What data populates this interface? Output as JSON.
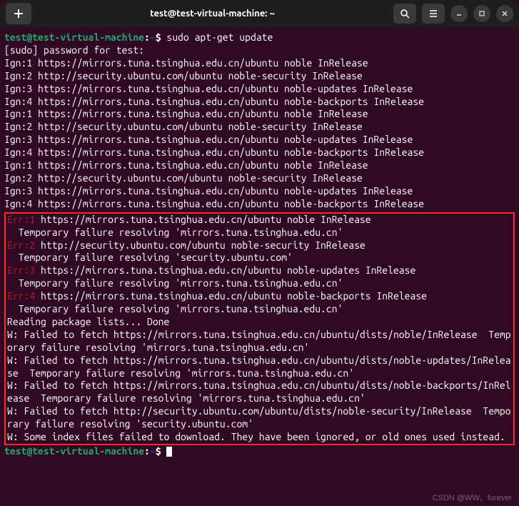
{
  "titlebar": {
    "title": "test@test-virtual-machine: ~"
  },
  "prompt": {
    "user_host": "test@test-virtual-machine",
    "sep": ":",
    "path": "~",
    "dollar": "$"
  },
  "command": "sudo apt-get update",
  "lines": {
    "sudo_pw": "[sudo] password for test:",
    "reading_done": "Reading package lists... Done"
  },
  "ign_block": [
    "Ign:1 https://mirrors.tuna.tsinghua.edu.cn/ubuntu noble InRelease",
    "Ign:2 http://security.ubuntu.com/ubuntu noble-security InRelease",
    "Ign:3 https://mirrors.tuna.tsinghua.edu.cn/ubuntu noble-updates InRelease",
    "Ign:4 https://mirrors.tuna.tsinghua.edu.cn/ubuntu noble-backports InRelease",
    "Ign:1 https://mirrors.tuna.tsinghua.edu.cn/ubuntu noble InRelease",
    "Ign:2 http://security.ubuntu.com/ubuntu noble-security InRelease",
    "Ign:3 https://mirrors.tuna.tsinghua.edu.cn/ubuntu noble-updates InRelease",
    "Ign:4 https://mirrors.tuna.tsinghua.edu.cn/ubuntu noble-backports InRelease",
    "Ign:1 https://mirrors.tuna.tsinghua.edu.cn/ubuntu noble InRelease",
    "Ign:2 http://security.ubuntu.com/ubuntu noble-security InRelease",
    "Ign:3 https://mirrors.tuna.tsinghua.edu.cn/ubuntu noble-updates InRelease",
    "Ign:4 https://mirrors.tuna.tsinghua.edu.cn/ubuntu noble-backports InRelease"
  ],
  "errors": [
    {
      "key": "Err:1",
      "rest": " https://mirrors.tuna.tsinghua.edu.cn/ubuntu noble InRelease"
    },
    {
      "key": "",
      "rest": "  Temporary failure resolving 'mirrors.tuna.tsinghua.edu.cn'"
    },
    {
      "key": "Err:2",
      "rest": " http://security.ubuntu.com/ubuntu noble-security InRelease"
    },
    {
      "key": "",
      "rest": "  Temporary failure resolving 'security.ubuntu.com'"
    },
    {
      "key": "Err:3",
      "rest": " https://mirrors.tuna.tsinghua.edu.cn/ubuntu noble-updates InRelease"
    },
    {
      "key": "",
      "rest": "  Temporary failure resolving 'mirrors.tuna.tsinghua.edu.cn'"
    },
    {
      "key": "Err:4",
      "rest": " https://mirrors.tuna.tsinghua.edu.cn/ubuntu noble-backports InRelease"
    },
    {
      "key": "",
      "rest": "  Temporary failure resolving 'mirrors.tuna.tsinghua.edu.cn'"
    }
  ],
  "warnings": [
    "W: Failed to fetch https://mirrors.tuna.tsinghua.edu.cn/ubuntu/dists/noble/InRelease  Temporary failure resolving 'mirrors.tuna.tsinghua.edu.cn'",
    "W: Failed to fetch https://mirrors.tuna.tsinghua.edu.cn/ubuntu/dists/noble-updates/InRelease  Temporary failure resolving 'mirrors.tuna.tsinghua.edu.cn'",
    "W: Failed to fetch https://mirrors.tuna.tsinghua.edu.cn/ubuntu/dists/noble-backports/InRelease  Temporary failure resolving 'mirrors.tuna.tsinghua.edu.cn'",
    "W: Failed to fetch http://security.ubuntu.com/ubuntu/dists/noble-security/InRelease  Temporary failure resolving 'security.ubuntu.com'",
    "W: Some index files failed to download. They have been ignored, or old ones used instead."
  ],
  "watermark": "CSDN @WW、forever"
}
